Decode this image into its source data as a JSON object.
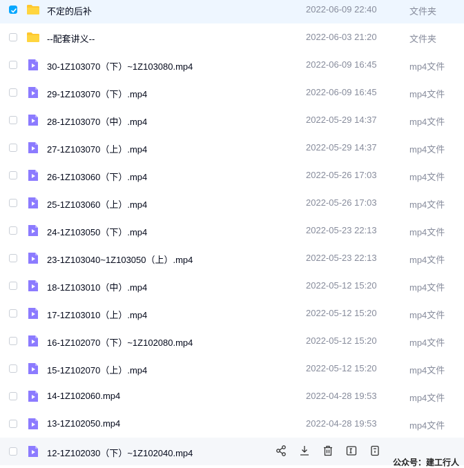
{
  "files": [
    {
      "name": "不定的后补",
      "date": "2022-06-09 22:40",
      "type": "文件夹",
      "kind": "folder",
      "selected": true
    },
    {
      "name": "--配套讲义--",
      "date": "2022-06-03 21:20",
      "type": "文件夹",
      "kind": "folder"
    },
    {
      "name": "30-1Z103070（下）~1Z103080.mp4",
      "date": "2022-06-09 16:45",
      "type": "mp4文件",
      "kind": "video"
    },
    {
      "name": "29-1Z103070（下）.mp4",
      "date": "2022-06-09 16:45",
      "type": "mp4文件",
      "kind": "video"
    },
    {
      "name": "28-1Z103070（中）.mp4",
      "date": "2022-05-29 14:37",
      "type": "mp4文件",
      "kind": "video"
    },
    {
      "name": "27-1Z103070（上）.mp4",
      "date": "2022-05-29 14:37",
      "type": "mp4文件",
      "kind": "video"
    },
    {
      "name": "26-1Z103060（下）.mp4",
      "date": "2022-05-26 17:03",
      "type": "mp4文件",
      "kind": "video"
    },
    {
      "name": "25-1Z103060（上）.mp4",
      "date": "2022-05-26 17:03",
      "type": "mp4文件",
      "kind": "video"
    },
    {
      "name": "24-1Z103050（下）.mp4",
      "date": "2022-05-23 22:13",
      "type": "mp4文件",
      "kind": "video"
    },
    {
      "name": "23-1Z103040~1Z103050（上）.mp4",
      "date": "2022-05-23 22:13",
      "type": "mp4文件",
      "kind": "video"
    },
    {
      "name": "18-1Z103010（中）.mp4",
      "date": "2022-05-12 15:20",
      "type": "mp4文件",
      "kind": "video"
    },
    {
      "name": "17-1Z103010（上）.mp4",
      "date": "2022-05-12 15:20",
      "type": "mp4文件",
      "kind": "video"
    },
    {
      "name": "16-1Z102070（下）~1Z102080.mp4",
      "date": "2022-05-12 15:20",
      "type": "mp4文件",
      "kind": "video"
    },
    {
      "name": "15-1Z102070（上）.mp4",
      "date": "2022-05-12 15:20",
      "type": "mp4文件",
      "kind": "video"
    },
    {
      "name": "14-1Z102060.mp4",
      "date": "2022-04-28 19:53",
      "type": "mp4文件",
      "kind": "video"
    },
    {
      "name": "13-1Z102050.mp4",
      "date": "2022-04-28 19:53",
      "type": "mp4文件",
      "kind": "video"
    },
    {
      "name": "12-1Z102030（下）~1Z102040.mp4",
      "kind": "video",
      "hovered": true
    }
  ],
  "row_actions": [
    "share-icon",
    "download-icon",
    "delete-icon",
    "rename-icon",
    "more-icon"
  ],
  "watermark": "公众号：建工行人",
  "colors": {
    "accent": "#06a7ff",
    "folder": "#ffc72e",
    "video": "#8c7bff",
    "muted": "#878c9c"
  }
}
